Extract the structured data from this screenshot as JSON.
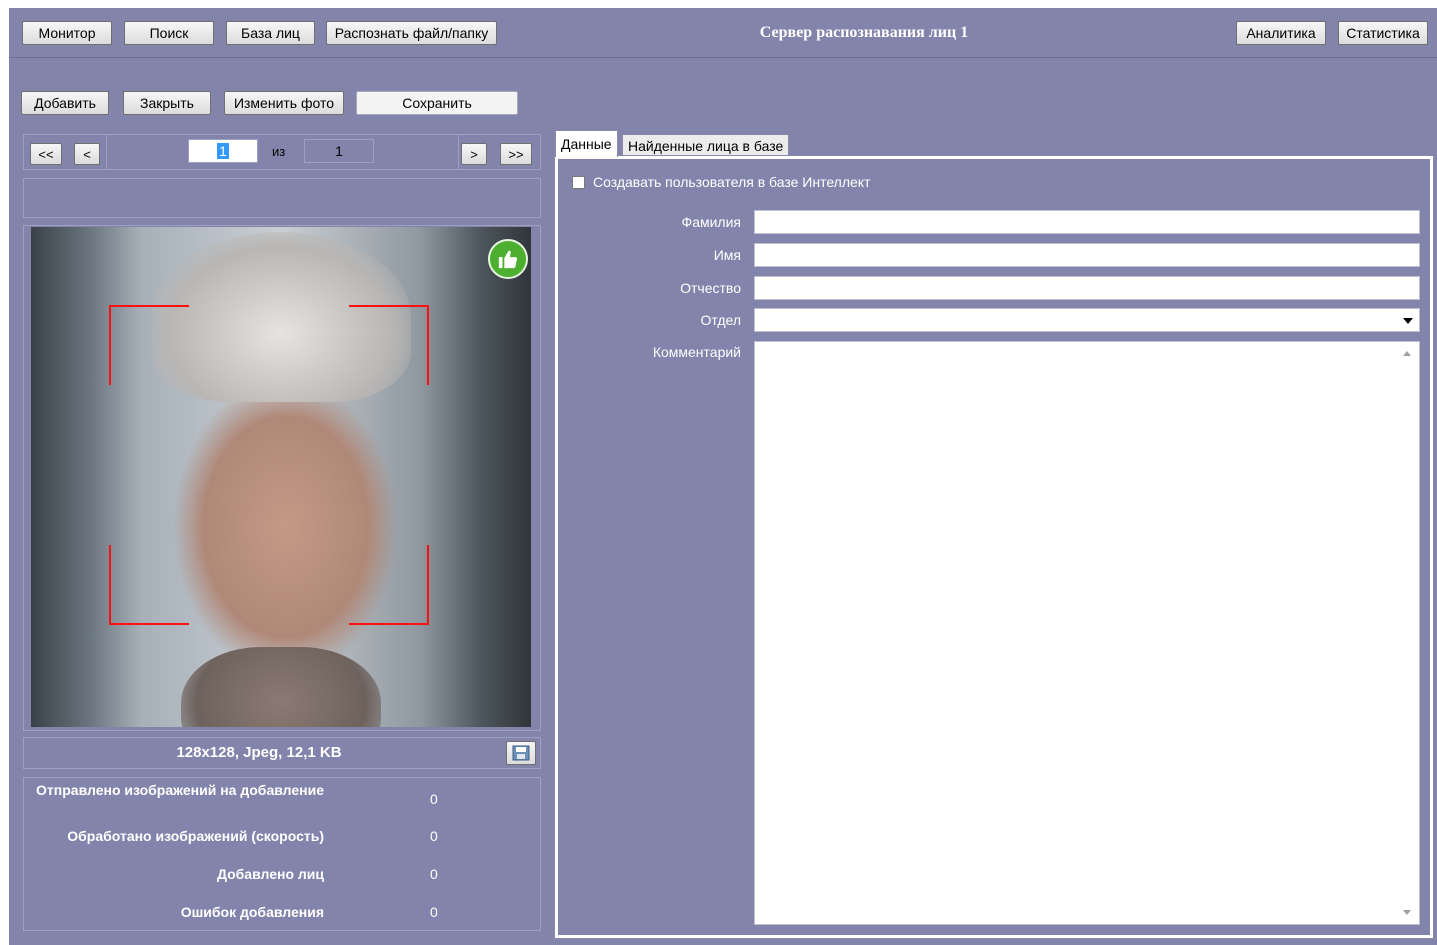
{
  "topbar": {
    "buttons": [
      "Монитор",
      "Поиск",
      "База лиц",
      "Распознать файл/папку"
    ],
    "title": "Сервер распознавания лиц 1",
    "right_buttons": [
      "Аналитика",
      "Статистика"
    ]
  },
  "toolbar": {
    "add_label": "Добавить",
    "close_label": "Закрыть",
    "change_photo_label": "Изменить фото",
    "save_label": "Сохранить"
  },
  "pager": {
    "first": "<<",
    "prev": "<",
    "current": "1",
    "of_label": "из",
    "total": "1",
    "next": ">",
    "last": ">>"
  },
  "photo": {
    "info": "128x128, Jpeg, 12,1 KB",
    "status_icon": "thumbs-up-icon",
    "frame_color": "#ff1010"
  },
  "stats": [
    {
      "label": "Отправлено изображений на добавление",
      "value": "0"
    },
    {
      "label": "Обработано изображений (скорость)",
      "value": "0"
    },
    {
      "label": "Добавлено лиц",
      "value": "0"
    },
    {
      "label": "Ошибок добавления",
      "value": "0"
    }
  ],
  "tabs": [
    {
      "label": "Данные",
      "active": true
    },
    {
      "label": "Найденные лица в базе",
      "active": false
    }
  ],
  "form": {
    "create_user_label": "Создавать пользователя в базе Интеллект",
    "create_user_checked": false,
    "surname_label": "Фамилия",
    "surname_value": "",
    "name_label": "Имя",
    "name_value": "",
    "patronymic_label": "Отчество",
    "patronymic_value": "",
    "department_label": "Отдел",
    "department_value": "",
    "comment_label": "Комментарий",
    "comment_value": ""
  },
  "colors": {
    "background": "#8384ab",
    "badge_green": "#4caf2f"
  }
}
